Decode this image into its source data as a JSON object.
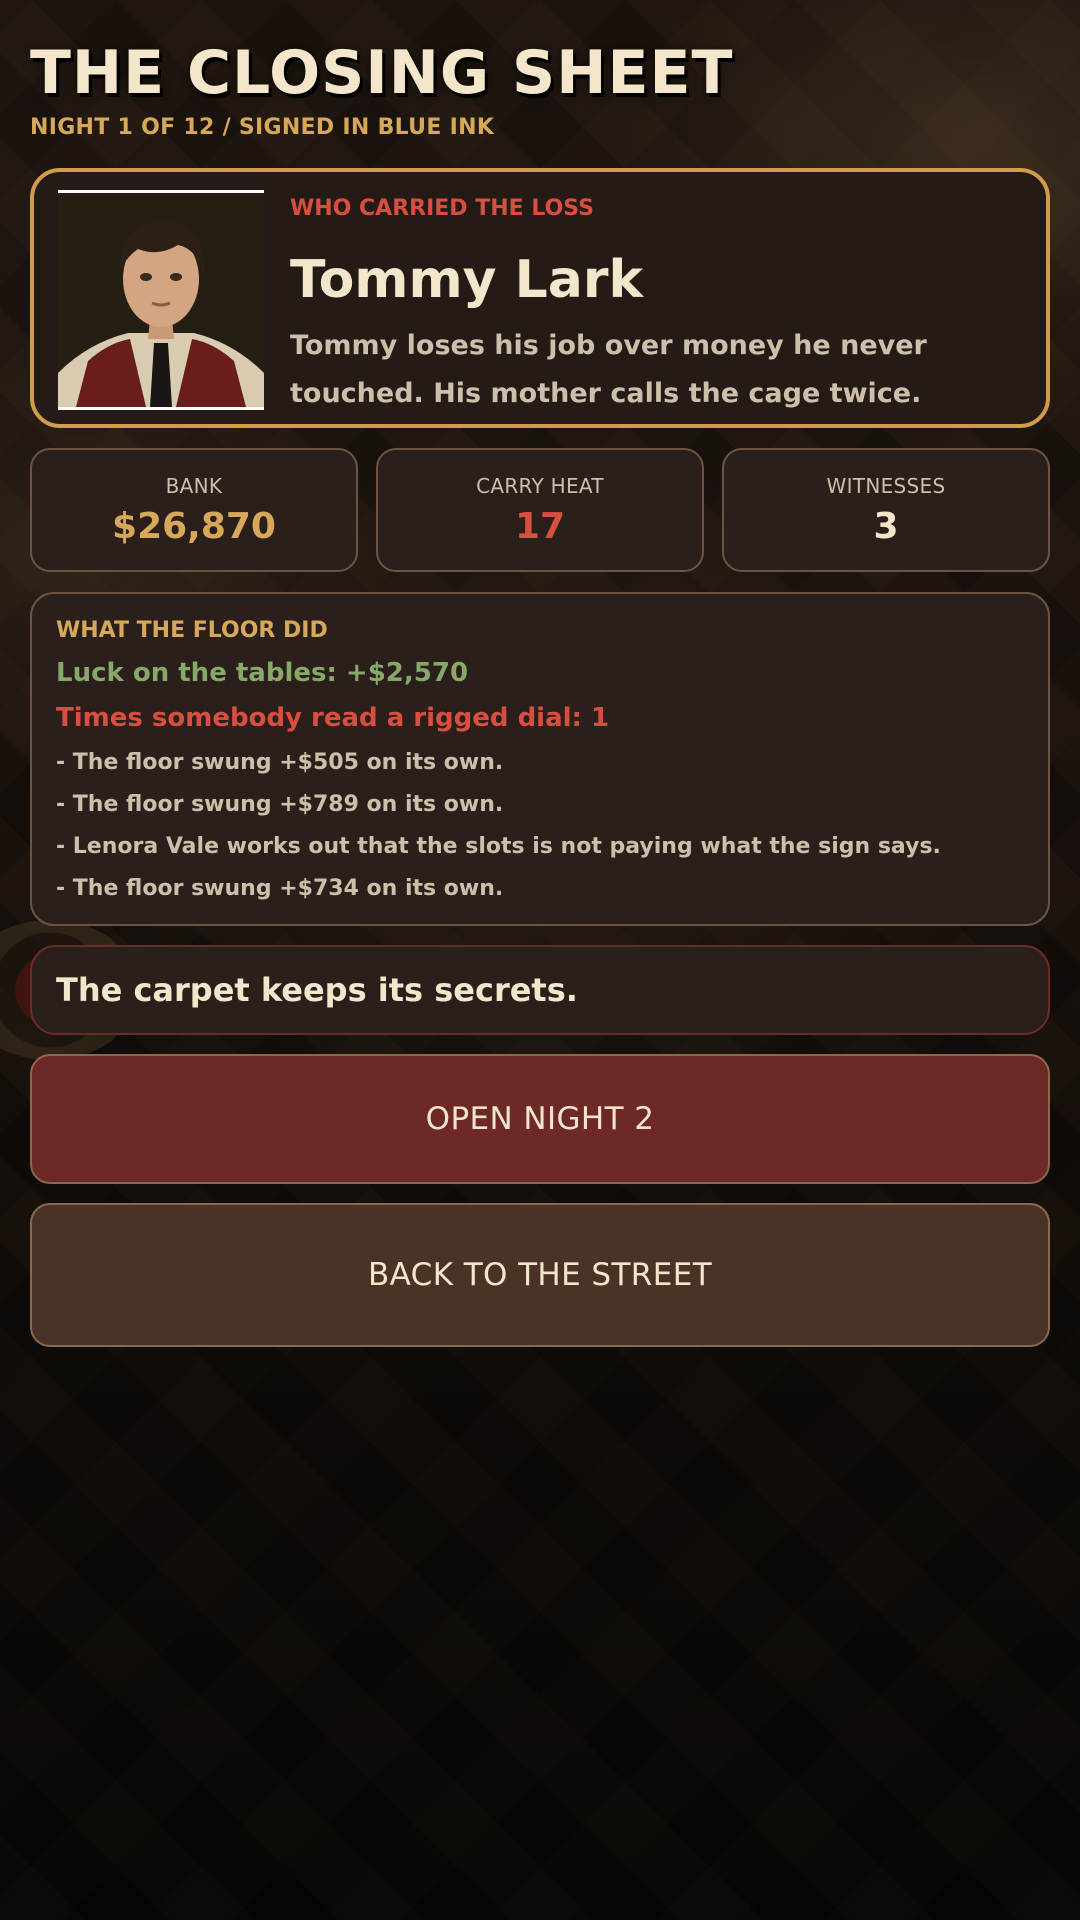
{
  "header": {
    "title": "THE CLOSING SHEET",
    "subtitle": "NIGHT 1 OF 12 / SIGNED IN BLUE INK"
  },
  "victim": {
    "label": "WHO CARRIED THE LOSS",
    "name": "Tommy Lark",
    "description": "Tommy loses his job over money he never touched. His mother calls the cage twice."
  },
  "stats": [
    {
      "label": "BANK",
      "value": "$26,870",
      "color": "#d7a85a"
    },
    {
      "label": "CARRY HEAT",
      "value": "17",
      "color": "#d94f3f"
    },
    {
      "label": "WITNESSES",
      "value": "3",
      "color": "#f4e6ca"
    }
  ],
  "floor_log": {
    "title": "WHAT THE FLOOR DID",
    "luck": "Luck on the tables: +$2,570",
    "rigged": "Times somebody read a rigged dial: 1",
    "entries": [
      "- The floor swung +$505 on its own.",
      "- The floor swung +$789 on its own.",
      "- Lenora Vale works out that the slots is not paying what the sign says.",
      "- The floor swung +$734 on its own."
    ]
  },
  "verdict": "The carpet keeps its secrets.",
  "actions": {
    "open_next": "OPEN NIGHT 2",
    "back": "BACK TO THE STREET"
  }
}
